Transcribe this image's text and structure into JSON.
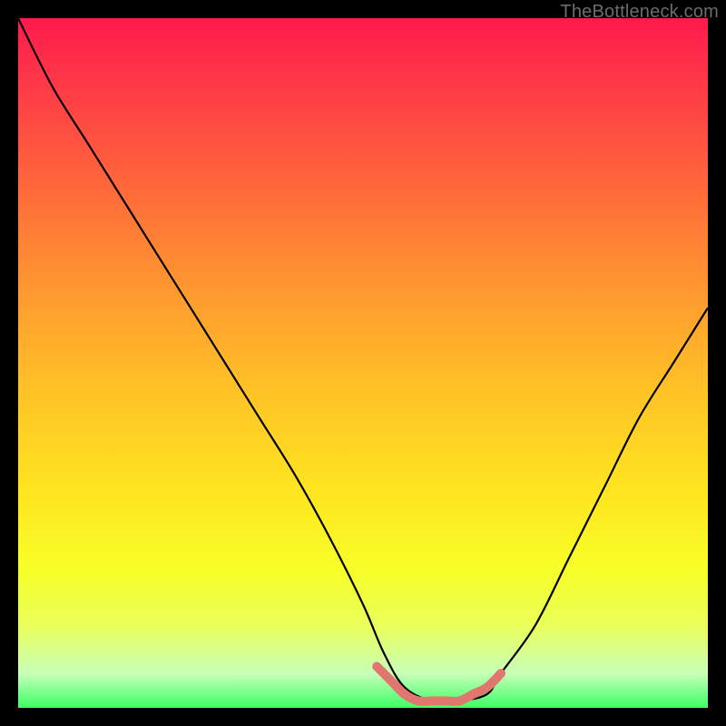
{
  "watermark": "TheBottleneck.com",
  "chart_data": {
    "type": "line",
    "title": "",
    "xlabel": "",
    "ylabel": "",
    "xlim": [
      0,
      100
    ],
    "ylim": [
      0,
      100
    ],
    "series": [
      {
        "name": "bottleneck-curve",
        "x": [
          0,
          5,
          10,
          15,
          20,
          25,
          30,
          35,
          40,
          45,
          50,
          53,
          56,
          60,
          64,
          68,
          70,
          75,
          80,
          85,
          90,
          95,
          100
        ],
        "values": [
          100,
          90,
          82,
          74,
          66,
          58,
          50,
          42,
          34,
          25,
          15,
          8,
          3,
          1,
          1,
          2,
          5,
          12,
          22,
          32,
          42,
          50,
          58
        ]
      },
      {
        "name": "optimal-zone-highlight",
        "x": [
          52,
          54,
          56,
          58,
          60,
          62,
          64,
          66,
          68,
          70
        ],
        "values": [
          6,
          4,
          2,
          1,
          1,
          1,
          1,
          2,
          3,
          5
        ]
      }
    ],
    "colors": {
      "curve": "#000000",
      "highlight": "#e0776f"
    }
  }
}
